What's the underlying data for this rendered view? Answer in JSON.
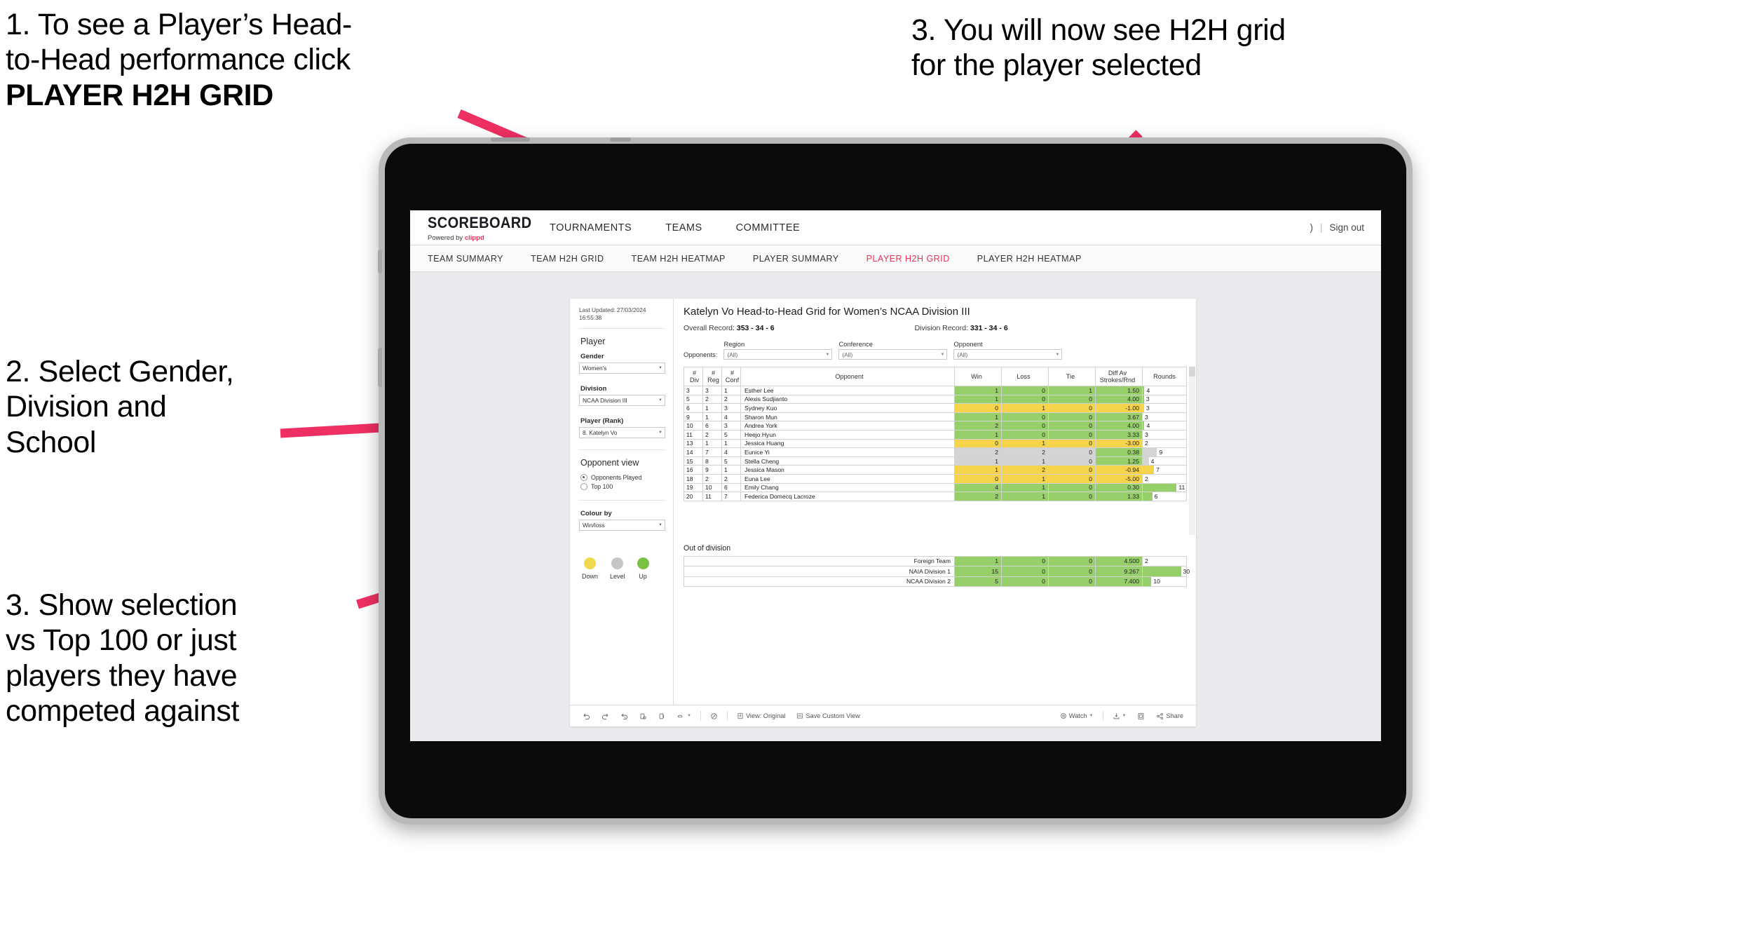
{
  "annotations": [
    {
      "id": "annot-1",
      "lines": [
        "1. To see a Player’s Head-",
        "to-Head performance click"
      ],
      "bold_line": "PLAYER H2H GRID"
    },
    {
      "id": "annot-2",
      "lines": [
        "2. Select Gender,",
        "Division and",
        "School"
      ],
      "bold_line": ""
    },
    {
      "id": "annot-3",
      "lines": [
        "3. Show selection",
        "vs Top 100 or just",
        "players they have",
        "competed against"
      ],
      "bold_line": ""
    },
    {
      "id": "annot-4",
      "lines": [
        "3. You will now see H2H grid",
        "for the player selected"
      ],
      "bold_line": ""
    }
  ],
  "annotation_text": {
    "a1_l1": "1. To see a Player’s Head-",
    "a1_l2": "to-Head performance click",
    "a1_bold": "PLAYER H2H GRID",
    "a2_l1": "2. Select Gender,",
    "a2_l2": "Division and",
    "a2_l3": "School",
    "a3_l1": "3. Show selection",
    "a3_l2": "vs Top 100 or just",
    "a3_l3": "players they have",
    "a3_l4": "competed against",
    "a4_l1": "3. You will now see H2H grid",
    "a4_l2": "for the player selected"
  },
  "colors": {
    "accent_pink": "#ED2F63",
    "arrow_pink": "#ED2F63",
    "brand_red": "#e8325a",
    "win_green": "#97cf6b",
    "loss_yellow": "#f5d44c",
    "level_grey": "#d4d4d4",
    "legend_down": "#f0d94e",
    "legend_level": "#c6c6c6",
    "legend_up": "#7ac143"
  },
  "topnav": {
    "brand_title": "SCOREBOARD",
    "brand_sub_prefix": "Powered by ",
    "brand_sub_name": "clippd",
    "links": [
      "TOURNAMENTS",
      "TEAMS",
      "COMMITTEE"
    ],
    "user_glyph": ")",
    "separator": "|",
    "sign_out": "Sign out"
  },
  "subnav": {
    "tabs": [
      {
        "label": "TEAM SUMMARY",
        "active": false
      },
      {
        "label": "TEAM H2H GRID",
        "active": false
      },
      {
        "label": "TEAM H2H HEATMAP",
        "active": false
      },
      {
        "label": "PLAYER SUMMARY",
        "active": false
      },
      {
        "label": "PLAYER H2H GRID",
        "active": true
      },
      {
        "label": "PLAYER H2H HEATMAP",
        "active": false
      }
    ]
  },
  "filter_panel": {
    "last_updated_line1": "Last Updated: 27/03/2024",
    "last_updated_line2": "16:55:38",
    "player_heading": "Player",
    "gender_label": "Gender",
    "gender_value": "Women's",
    "division_label": "Division",
    "division_value": "NCAA Division III",
    "player_rank_label": "Player (Rank)",
    "player_rank_value": "8. Katelyn Vo",
    "opponent_view_heading": "Opponent view",
    "radio_opponents_played": "Opponents Played",
    "radio_top100": "Top 100",
    "radio_selected": "Opponents Played",
    "colour_by_label": "Colour by",
    "colour_by_value": "Win/loss",
    "legend": [
      {
        "label": "Down",
        "color": "#f0d94e"
      },
      {
        "label": "Level",
        "color": "#c6c6c6"
      },
      {
        "label": "Up",
        "color": "#7ac143"
      }
    ]
  },
  "viz": {
    "title": "Katelyn Vo Head-to-Head Grid for Women’s NCAA Division III",
    "overall_record_label": "Overall Record:",
    "overall_record_value": "353 -  34 - 6",
    "division_record_label": "Division Record:",
    "division_record_value": "331 -  34 - 6",
    "opponents_label": "Opponents:",
    "opponent_filters": [
      {
        "caption": "Region",
        "value": "(All)"
      },
      {
        "caption": "Conference",
        "value": "(All)"
      },
      {
        "caption": "Opponent",
        "value": "(All)"
      }
    ],
    "table_headers": {
      "div_l1": "#",
      "div_l2": "Div",
      "reg_l1": "#",
      "reg_l2": "Reg",
      "conf_l1": "#",
      "conf_l2": "Conf",
      "opponent": "Opponent",
      "win": "Win",
      "loss": "Loss",
      "tie": "Tie",
      "diff_l1": "Diff Av",
      "diff_l2": "Strokes/Rnd",
      "rounds": "Rounds"
    },
    "rows": [
      {
        "div": "3",
        "reg": "3",
        "conf": "1",
        "opponent": "Esther Lee",
        "win": "1",
        "loss": "0",
        "tie": "1",
        "diff": "1.50",
        "rounds": "4",
        "color": "g",
        "bar_pct": 4
      },
      {
        "div": "5",
        "reg": "2",
        "conf": "2",
        "opponent": "Alexis Sudjianto",
        "win": "1",
        "loss": "0",
        "tie": "0",
        "diff": "4.00",
        "rounds": "3",
        "color": "g",
        "bar_pct": 3
      },
      {
        "div": "6",
        "reg": "1",
        "conf": "3",
        "opponent": "Sydney Kuo",
        "win": "0",
        "loss": "1",
        "tie": "0",
        "diff": "-1.00",
        "rounds": "3",
        "color": "y",
        "bar_pct": 3
      },
      {
        "div": "9",
        "reg": "1",
        "conf": "4",
        "opponent": "Sharon Mun",
        "win": "1",
        "loss": "0",
        "tie": "0",
        "diff": "3.67",
        "rounds": "3",
        "color": "g",
        "bar_pct": 0
      },
      {
        "div": "10",
        "reg": "6",
        "conf": "3",
        "opponent": "Andrea York",
        "win": "2",
        "loss": "0",
        "tie": "0",
        "diff": "4.00",
        "rounds": "4",
        "color": "g",
        "bar_pct": 4
      },
      {
        "div": "11",
        "reg": "2",
        "conf": "5",
        "opponent": "Heejo Hyun",
        "win": "1",
        "loss": "0",
        "tie": "0",
        "diff": "3.33",
        "rounds": "3",
        "color": "g",
        "bar_pct": 0
      },
      {
        "div": "13",
        "reg": "1",
        "conf": "1",
        "opponent": "Jessica Huang",
        "win": "0",
        "loss": "1",
        "tie": "0",
        "diff": "-3.00",
        "rounds": "2",
        "color": "y",
        "bar_pct": 0
      },
      {
        "div": "14",
        "reg": "7",
        "conf": "4",
        "opponent": "Eunice Yi",
        "win": "2",
        "loss": "2",
        "tie": "0",
        "diff": "0.38",
        "rounds": "9",
        "color": "n",
        "bar_pct": 33
      },
      {
        "div": "15",
        "reg": "8",
        "conf": "5",
        "opponent": "Stella Cheng",
        "win": "1",
        "loss": "1",
        "tie": "0",
        "diff": "1.25",
        "rounds": "4",
        "color": "n",
        "bar_pct": 14
      },
      {
        "div": "16",
        "reg": "9",
        "conf": "1",
        "opponent": "Jessica Mason",
        "win": "1",
        "loss": "2",
        "tie": "0",
        "diff": "-0.94",
        "rounds": "7",
        "color": "y",
        "bar_pct": 26
      },
      {
        "div": "18",
        "reg": "2",
        "conf": "2",
        "opponent": "Euna Lee",
        "win": "0",
        "loss": "1",
        "tie": "0",
        "diff": "-5.00",
        "rounds": "2",
        "color": "y",
        "bar_pct": 0
      },
      {
        "div": "19",
        "reg": "10",
        "conf": "6",
        "opponent": "Emily Chang",
        "win": "4",
        "loss": "1",
        "tie": "0",
        "diff": "0.30",
        "rounds": "11",
        "color": "g",
        "bar_pct": 78
      },
      {
        "div": "20",
        "reg": "11",
        "conf": "7",
        "opponent": "Federica Domecq Lacroze",
        "win": "2",
        "loss": "1",
        "tie": "0",
        "diff": "1.33",
        "rounds": "6",
        "color": "g",
        "bar_pct": 22
      }
    ],
    "out_of_division_title": "Out of division",
    "out_of_division_rows": [
      {
        "label": "Foreign Team",
        "win": "1",
        "loss": "0",
        "tie": "0",
        "diff": "4.500",
        "rounds": "2",
        "color": "g",
        "bar_pct": 0
      },
      {
        "label": "NAIA Division 1",
        "win": "15",
        "loss": "0",
        "tie": "0",
        "diff": "9.267",
        "rounds": "30",
        "color": "g",
        "bar_pct": 88
      },
      {
        "label": "NCAA Division 2",
        "win": "5",
        "loss": "0",
        "tie": "0",
        "diff": "7.400",
        "rounds": "10",
        "color": "g",
        "bar_pct": 20
      }
    ]
  },
  "toolbar": {
    "view_label": "View: Original",
    "save_label": "Save Custom View",
    "watch_label": "Watch",
    "share_label": "Share"
  }
}
